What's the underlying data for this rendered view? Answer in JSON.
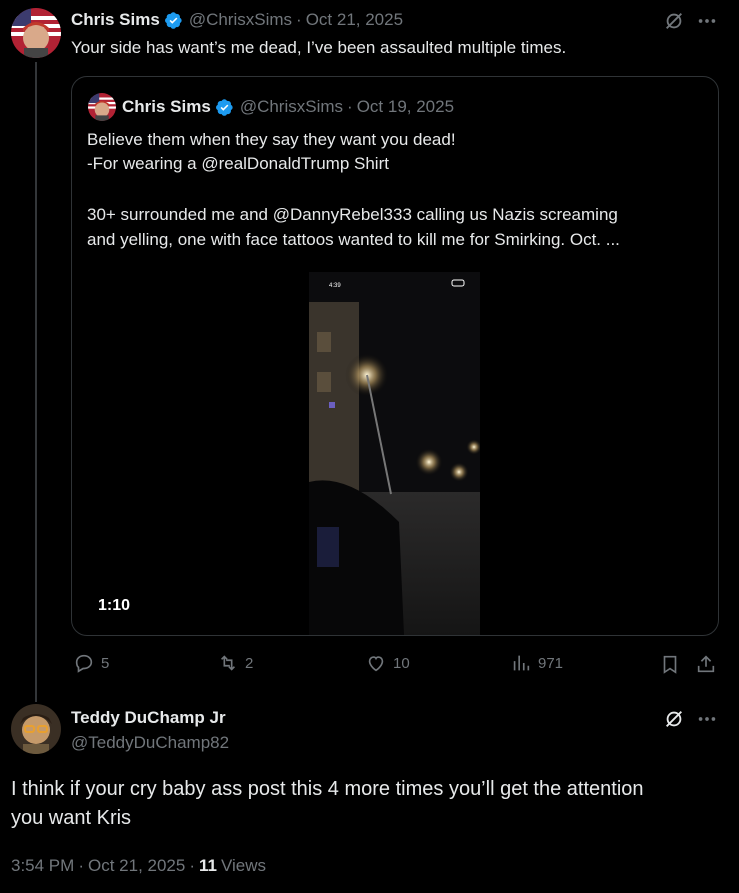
{
  "main_post": {
    "name": "Chris Sims",
    "handle": "@ChrisxSims",
    "separator": "·",
    "date": "Oct 21, 2025",
    "text": "Your side has want’s me dead, I’ve been assaulted multiple times."
  },
  "quoted_post": {
    "name": "Chris Sims",
    "handle": "@ChrisxSims",
    "separator": "·",
    "date": "Oct 19, 2025",
    "line1": "Believe them when they say they want you dead!",
    "line2": "-For wearing a @realDonaldTrump Shirt",
    "line3": "30+ surrounded me and @DannyRebel333 calling us Nazis screaming",
    "line4": "and yelling, one with face tattoos wanted to kill me for Smirking. Oct. ...",
    "video": {
      "status_time": "4:39",
      "duration": "1:10"
    }
  },
  "actions": {
    "replies": "5",
    "reposts": "2",
    "likes": "10",
    "views": "971"
  },
  "reply": {
    "name": "Teddy DuChamp Jr",
    "handle": "@TeddyDuChamp82",
    "line1": "I think if your cry baby ass post this 4 more times you’ll get the attention",
    "line2": "you want Kris",
    "time": "3:54 PM",
    "separator": "·",
    "date": "Oct 21, 2025",
    "views_count": "11",
    "views_label": "Views"
  },
  "colors": {
    "background": "#000000",
    "text": "#e7e9ea",
    "muted": "#71767b",
    "verified": "#1d9bf0",
    "border": "#2f3336"
  }
}
